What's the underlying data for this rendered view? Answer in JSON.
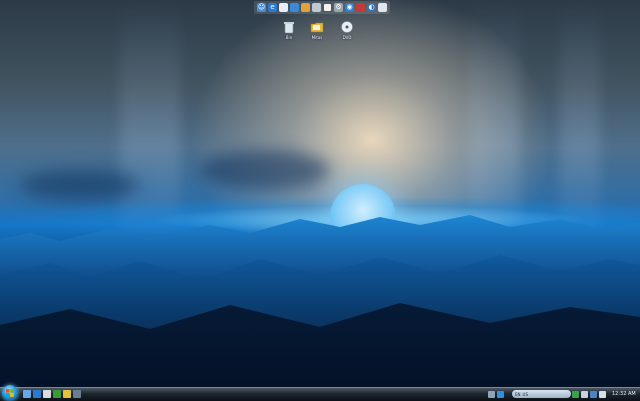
{
  "desktop": {
    "icons": [
      {
        "name": "recycle-bin",
        "label": "Bin"
      },
      {
        "name": "folder",
        "label": "Mitas"
      },
      {
        "name": "dvd-drive",
        "label": "DVD"
      }
    ]
  },
  "dock": {
    "items": [
      "people-icon",
      "ie-icon",
      "doc-icon",
      "app-icon",
      "book-icon",
      "shield-icon",
      "terminal-icon",
      "gear-icon",
      "globe-icon",
      "flag-icon",
      "media-icon",
      "notes-icon"
    ]
  },
  "taskbar": {
    "language": "EN",
    "tray_label": "US",
    "clock": "12:32 AM"
  },
  "colors": {
    "accent": "#1576c8",
    "taskbar": "#1c252d"
  }
}
